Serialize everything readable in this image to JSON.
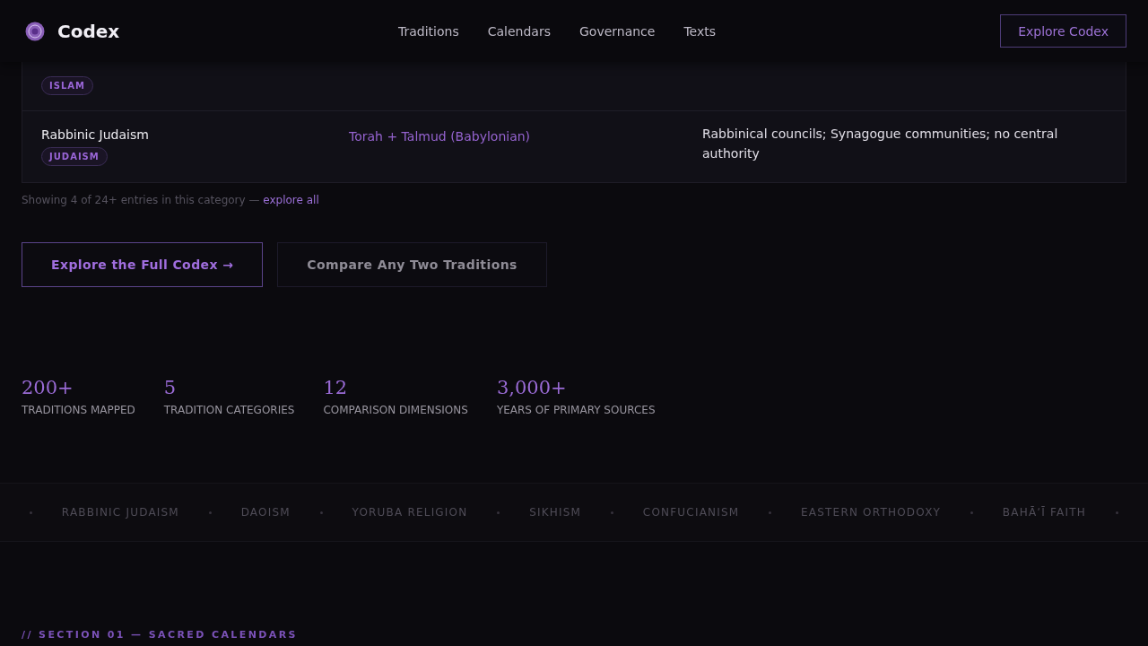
{
  "header": {
    "brand": "Codex",
    "nav": [
      "Traditions",
      "Calendars",
      "Governance",
      "Texts"
    ],
    "cta": "Explore Codex"
  },
  "table": {
    "rows": [
      {
        "tag": "ISLAM"
      },
      {
        "name": "Rabbinic Judaism",
        "tag": "JUDAISM",
        "texts": "Torah + Talmud (Babylonian)",
        "governance": "Rabbinical councils; Synagogue communities; no central authority"
      }
    ]
  },
  "note": {
    "text": "Showing 4 of 24+ entries in this category —",
    "link": "explore all"
  },
  "buttons": [
    {
      "label": "Explore the Full Codex →",
      "kind": "primary"
    },
    {
      "label": "Compare Any Two Traditions",
      "kind": "secondary"
    }
  ],
  "stats": [
    {
      "value": "200+",
      "label": "TRADITIONS MAPPED"
    },
    {
      "value": "5",
      "label": "TRADITION CATEGORIES"
    },
    {
      "value": "12",
      "label": "COMPARISON DIMENSIONS"
    },
    {
      "value": "3,000+",
      "label": "YEARS OF PRIMARY SOURCES"
    }
  ],
  "ticker": [
    "RABBINIC JUDAISM",
    "DAOISM",
    "YORUBA RELIGION",
    "SIKHISM",
    "CONFUCIANISM",
    "EASTERN ORTHODOXY",
    "BAHĀʼĪ FAITH"
  ],
  "section_label": "// SECTION 01 — SACRED CALENDARS"
}
